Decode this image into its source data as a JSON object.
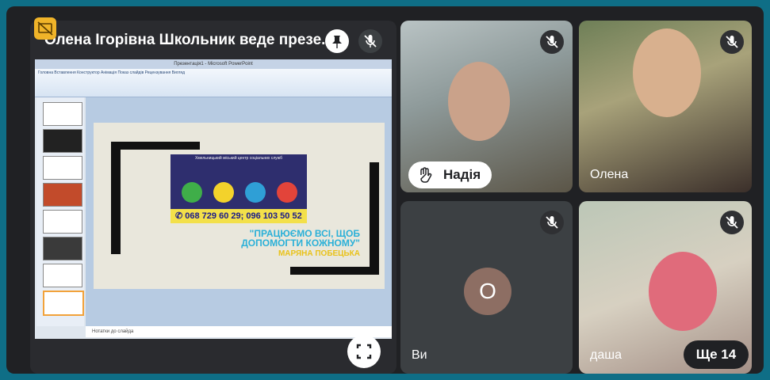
{
  "presenter": {
    "title": "Олена Ігорівна Школьник веде презе...",
    "pin_icon": "pin-icon",
    "mic_icon": "mic-off-icon"
  },
  "ppt": {
    "window_title": "Презентація1 - Microsoft PowerPoint",
    "ribbon_tabs": "Головна   Вставлення   Конструктор   Анімація   Показ слайдів   Рецензування   Вигляд",
    "notes_placeholder": "Нотатки до слайда",
    "slide": {
      "banner_title": "Хмельницький міський центр соціальних служб",
      "phone": "✆ 068 729 60 29; 096 103 50 52",
      "slogan": "\"ПРАЦЮЄМО ВСІ, ЩОБ ДОПОМОГТИ КОЖНОМУ\"",
      "author": "МАРЯНА ПОБЕЦЬКА"
    }
  },
  "participants": [
    {
      "name": "Надія",
      "raised_hand": true
    },
    {
      "name": "Олена"
    },
    {
      "name": "Ви",
      "avatar_letter": "О"
    },
    {
      "name": "даша"
    }
  ],
  "more": {
    "label": "Ще 14"
  },
  "colors": {
    "frame": "#0f6e86",
    "background": "#202124",
    "avatar": "#8d6e63",
    "accent_badge": "#f0b429"
  }
}
